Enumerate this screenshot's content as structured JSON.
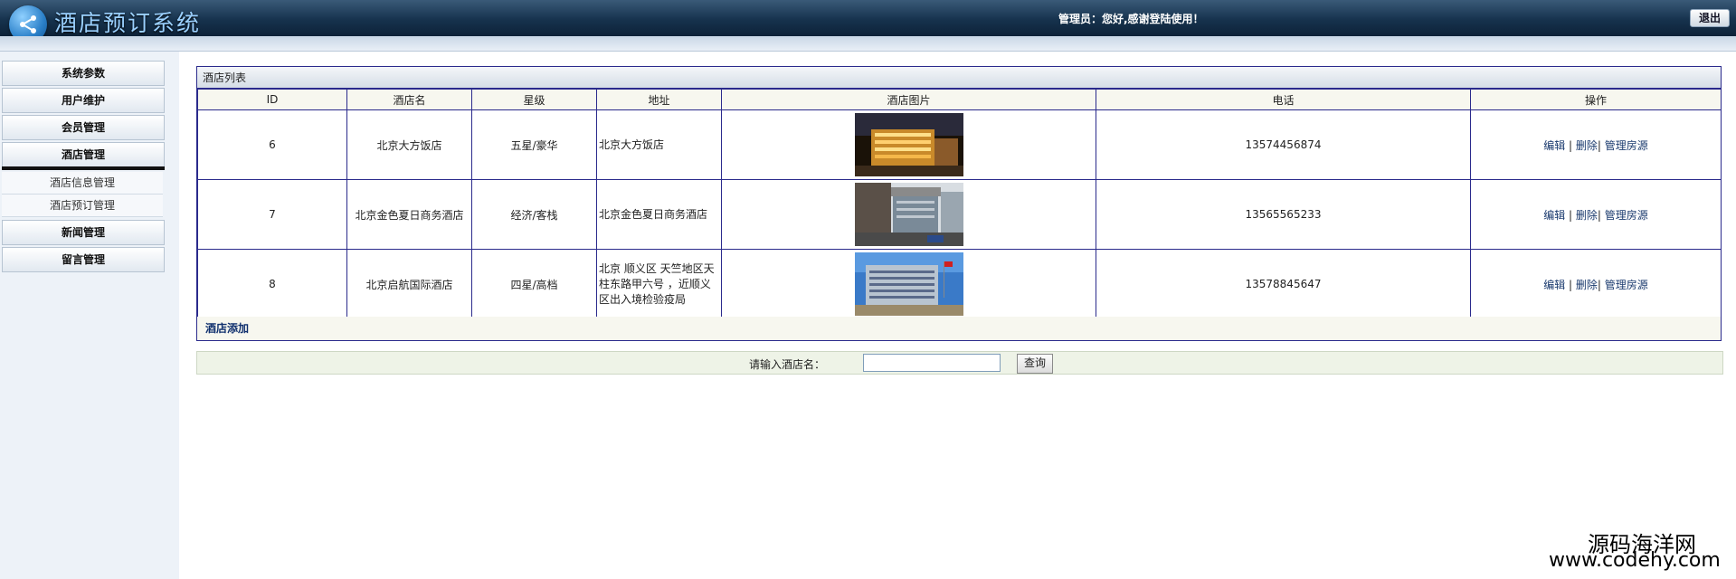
{
  "header": {
    "title": "酒店预订系统",
    "greeting": "管理员：您好,感谢登陆使用！",
    "logout_label": "退出"
  },
  "sidebar": {
    "items": [
      {
        "label": "系统参数"
      },
      {
        "label": "用户维护"
      },
      {
        "label": "会员管理"
      },
      {
        "label": "酒店管理"
      },
      {
        "label": "新闻管理"
      },
      {
        "label": "留言管理"
      }
    ],
    "submenu": [
      {
        "label": "酒店信息管理"
      },
      {
        "label": "酒店预订管理"
      }
    ]
  },
  "panel": {
    "title": "酒店列表",
    "columns": [
      "ID",
      "酒店名",
      "星级",
      "地址",
      "酒店图片",
      "电话",
      "操作"
    ],
    "rows": [
      {
        "id": "6",
        "name": "北京大方饭店",
        "star": "五星/豪华",
        "address": "北京大方饭店",
        "phone": "13574456874"
      },
      {
        "id": "7",
        "name": "北京金色夏日商务酒店",
        "star": "经济/客栈",
        "address": "北京金色夏日商务酒店",
        "phone": "13565565233"
      },
      {
        "id": "8",
        "name": "北京启航国际酒店",
        "star": "四星/高档",
        "address": "北京 顺义区 天竺地区天柱东路甲六号 ，近顺义区出入境检验疫局",
        "phone": "13578845647"
      }
    ],
    "actions": {
      "edit": "编辑",
      "delete": "删除",
      "manage": "管理房源",
      "sep": "|"
    },
    "add_label": "酒店添加"
  },
  "search": {
    "label": "请输入酒店名：",
    "value": "",
    "button_label": "查询"
  },
  "watermark": {
    "line1": "源码海洋网",
    "line2": "www.codehy.com"
  }
}
